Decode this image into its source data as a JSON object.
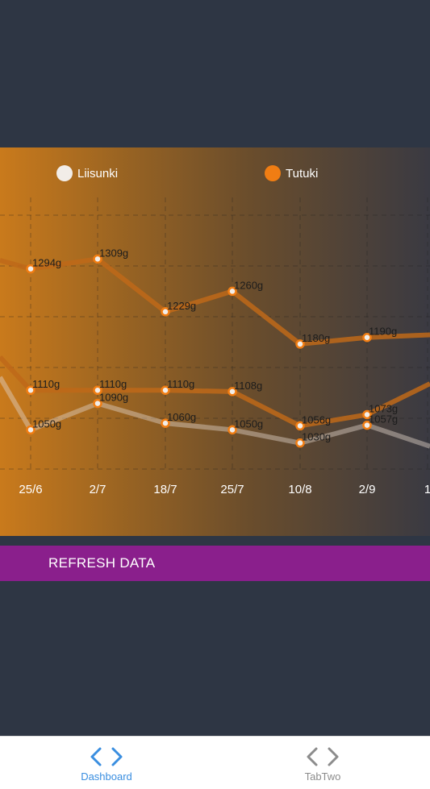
{
  "chart_data": {
    "type": "line",
    "categories": [
      "25/6",
      "2/7",
      "18/7",
      "25/7",
      "10/8",
      "2/9",
      "1"
    ],
    "series": [
      {
        "name": "Tutuki",
        "values": [
          1294,
          1309,
          1229,
          1260,
          1180,
          1190,
          null
        ],
        "labels": [
          "1294g",
          "1309g",
          "1229g",
          "1260g",
          "1180g",
          "1190g",
          ""
        ]
      },
      {
        "name": "",
        "values": [
          1110,
          1110,
          1110,
          1108,
          1056,
          1073,
          null
        ],
        "labels": [
          "1110g",
          "1110g",
          "1110g",
          "1108g",
          "1056g",
          "1073g",
          ""
        ]
      },
      {
        "name": "Liisunki",
        "values": [
          1050,
          1090,
          1060,
          1050,
          1030,
          1057,
          null
        ],
        "labels": [
          "1050g",
          "1090g",
          "1060g",
          "1050g",
          "1030g",
          "1057g",
          ""
        ]
      }
    ],
    "grid": true,
    "legend": "top"
  },
  "legend": [
    {
      "label": "Liisunki",
      "color": "#f2ede8"
    },
    {
      "label": "Tutuki",
      "color": "#f07d13"
    }
  ],
  "refresh_button": {
    "label": "REFRESH DATA"
  },
  "tabs": [
    {
      "label": "Dashboard",
      "icon": "code-icon",
      "color": "#3a8ee0"
    },
    {
      "label": "TabTwo",
      "icon": "code-icon",
      "color": "#8c8c8c"
    }
  ],
  "colors": {
    "background": "#2e3644",
    "accent": "#8a1f8c",
    "marker": "#f07d13"
  }
}
